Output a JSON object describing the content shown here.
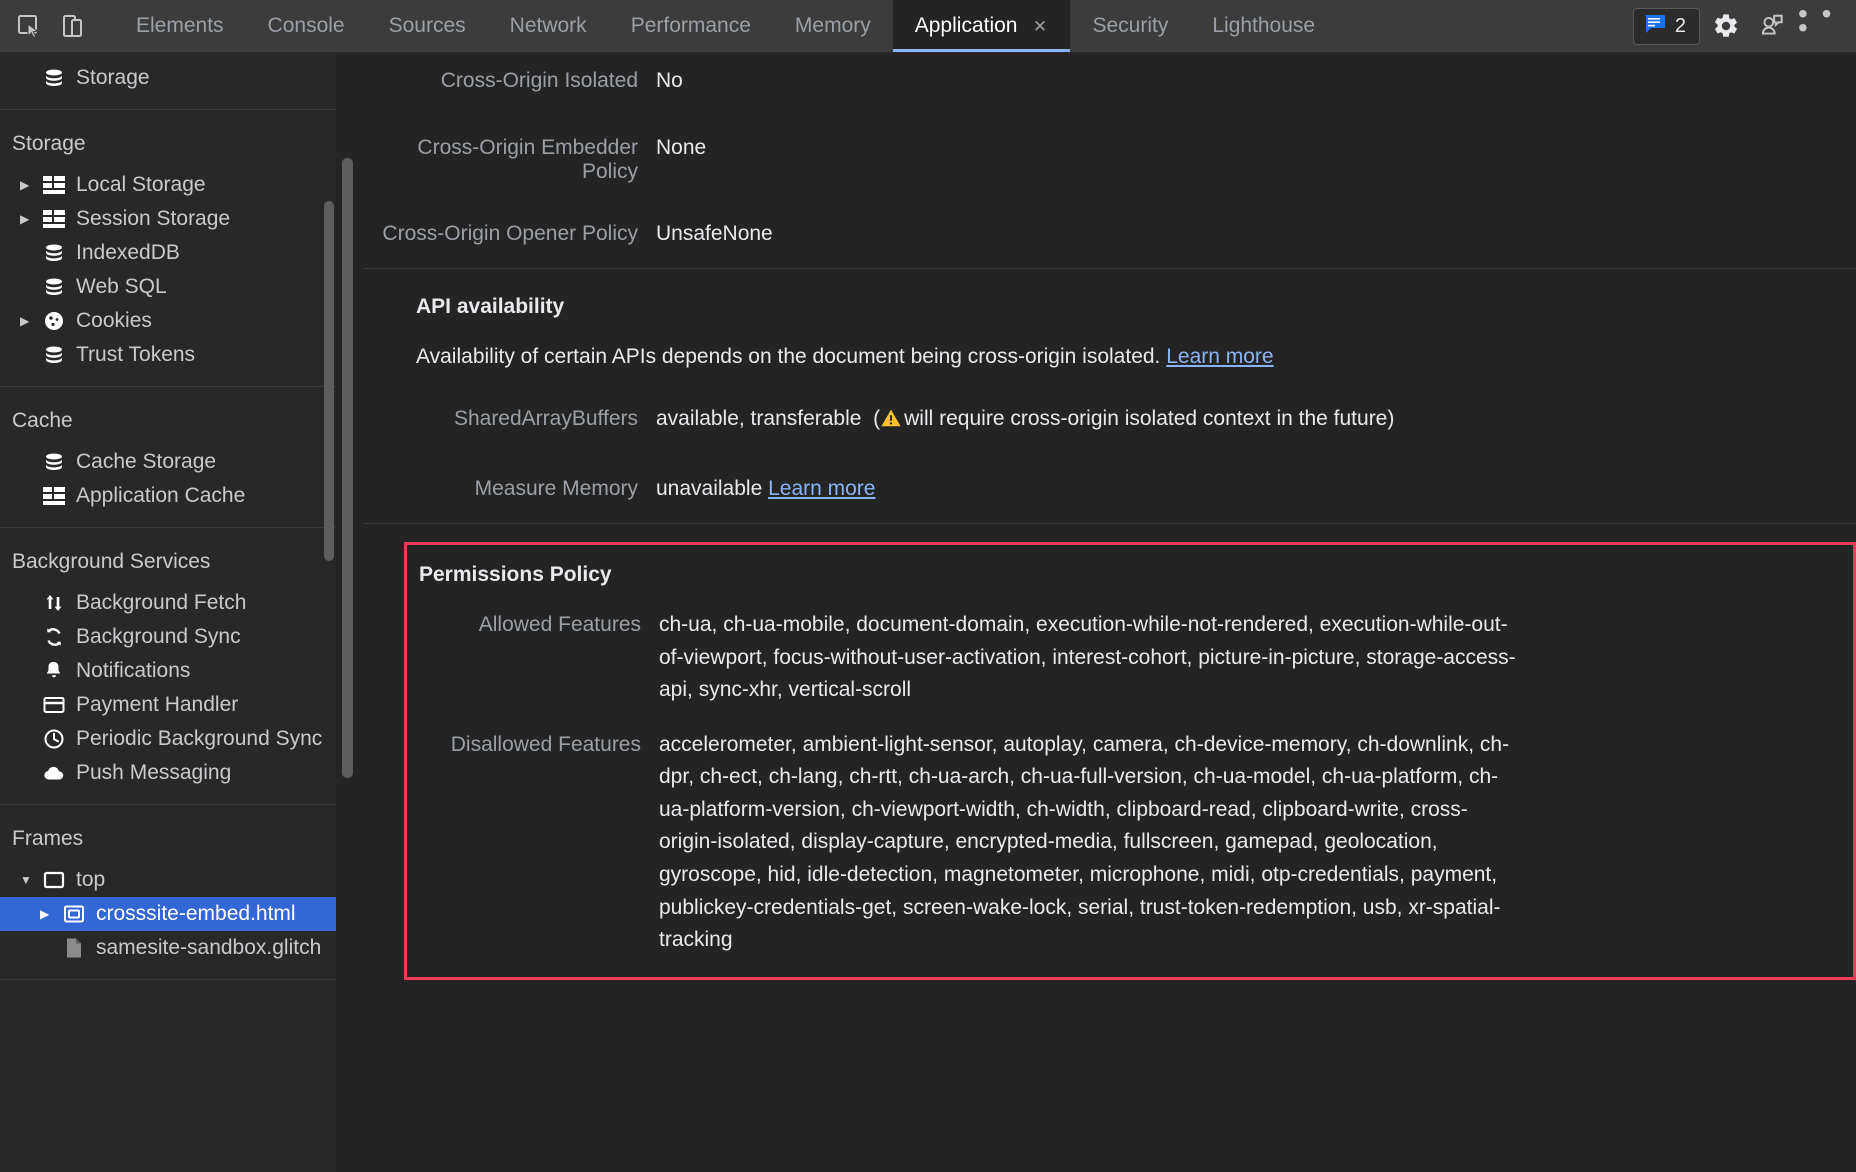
{
  "toolbar": {
    "icons": [
      {
        "name": "inspect-element-icon",
        "label": "Inspect element"
      },
      {
        "name": "device-toolbar-icon",
        "label": "Toggle device toolbar"
      }
    ],
    "tabs": [
      {
        "label": "Elements",
        "active": false
      },
      {
        "label": "Console",
        "active": false
      },
      {
        "label": "Sources",
        "active": false
      },
      {
        "label": "Network",
        "active": false
      },
      {
        "label": "Performance",
        "active": false
      },
      {
        "label": "Memory",
        "active": false
      },
      {
        "label": "Application",
        "active": true,
        "closeable": true
      },
      {
        "label": "Security",
        "active": false
      },
      {
        "label": "Lighthouse",
        "active": false
      }
    ],
    "close_glyph": "✕",
    "message_badge": {
      "icon": "message-bubble-icon",
      "count": "2",
      "color": "#1a73e8"
    },
    "settings_icon": "gear-icon",
    "customize_icon": "more-options-icon",
    "more_glyph": "• • •"
  },
  "sidebar": {
    "sections": [
      {
        "title": "",
        "items": [
          {
            "label": "Storage",
            "icon": "database-icon",
            "arrow": false,
            "indent": 1
          }
        ]
      },
      {
        "title": "Storage",
        "items": [
          {
            "label": "Local Storage",
            "icon": "table-icon",
            "arrow": true,
            "indent": 1
          },
          {
            "label": "Session Storage",
            "icon": "table-icon",
            "arrow": true,
            "indent": 1
          },
          {
            "label": "IndexedDB",
            "icon": "database-icon",
            "arrow": false,
            "indent": 1
          },
          {
            "label": "Web SQL",
            "icon": "database-icon",
            "arrow": false,
            "indent": 1
          },
          {
            "label": "Cookies",
            "icon": "cookie-icon",
            "arrow": true,
            "indent": 1
          },
          {
            "label": "Trust Tokens",
            "icon": "database-icon",
            "arrow": false,
            "indent": 1
          }
        ]
      },
      {
        "title": "Cache",
        "items": [
          {
            "label": "Cache Storage",
            "icon": "database-icon",
            "arrow": false,
            "indent": 1
          },
          {
            "label": "Application Cache",
            "icon": "table-icon",
            "arrow": false,
            "indent": 1
          }
        ]
      },
      {
        "title": "Background Services",
        "items": [
          {
            "label": "Background Fetch",
            "icon": "updown-arrows-icon",
            "arrow": false,
            "indent": 1
          },
          {
            "label": "Background Sync",
            "icon": "sync-icon",
            "arrow": false,
            "indent": 1
          },
          {
            "label": "Notifications",
            "icon": "bell-icon",
            "arrow": false,
            "indent": 1
          },
          {
            "label": "Payment Handler",
            "icon": "credit-card-icon",
            "arrow": false,
            "indent": 1
          },
          {
            "label": "Periodic Background Sync",
            "icon": "clock-icon",
            "arrow": false,
            "indent": 1
          },
          {
            "label": "Push Messaging",
            "icon": "cloud-icon",
            "arrow": false,
            "indent": 1
          }
        ]
      },
      {
        "title": "Frames",
        "items": [
          {
            "label": "top",
            "icon": "frame-icon",
            "arrow": true,
            "expanded": true,
            "indent": 1
          },
          {
            "label": "crosssite-embed.html",
            "icon": "iframe-icon",
            "arrow": true,
            "indent": 2,
            "selected": true
          },
          {
            "label": "samesite-sandbox.glitch",
            "icon": "document-icon",
            "arrow": false,
            "indent": 2
          }
        ]
      }
    ],
    "arrow_collapsed": "▶",
    "arrow_expanded": "▼",
    "selected_color": "#3367d6"
  },
  "main": {
    "security_rows": [
      {
        "label": "Cross-Origin Isolated",
        "value": "No"
      },
      {
        "label": "Cross-Origin Embedder Policy",
        "value": "None"
      },
      {
        "label": "Cross-Origin Opener Policy",
        "value": "UnsafeNone"
      }
    ],
    "api_availability": {
      "heading": "API availability",
      "description": "Availability of certain APIs depends on the document being cross-origin isolated. ",
      "description_link": "Learn more",
      "shared_array_buffers": {
        "label": "SharedArrayBuffers",
        "value": "available, transferable",
        "note_open": "(",
        "warning_icon": "warning-triangle-icon",
        "note": "will require cross-origin isolated context in the future)"
      },
      "measure_memory": {
        "label": "Measure Memory",
        "value": "unavailable ",
        "link": "Learn more"
      }
    },
    "permissions_policy": {
      "heading": "Permissions Policy",
      "highlight_color": "#f23a5b",
      "allowed": {
        "label": "Allowed Features",
        "value": "ch-ua, ch-ua-mobile, document-domain, execution-while-not-rendered, execution-while-out-of-viewport, focus-without-user-activation, interest-cohort, picture-in-picture, storage-access-api, sync-xhr, vertical-scroll"
      },
      "disallowed": {
        "label": "Disallowed Features",
        "value": "accelerometer, ambient-light-sensor, autoplay, camera, ch-device-memory, ch-downlink, ch-dpr, ch-ect, ch-lang, ch-rtt, ch-ua-arch, ch-ua-full-version, ch-ua-model, ch-ua-platform, ch-ua-platform-version, ch-viewport-width, ch-width, clipboard-read, clipboard-write, cross-origin-isolated, display-capture, encrypted-media, fullscreen, gamepad, geolocation, gyroscope, hid, idle-detection, magnetometer, microphone, midi, otp-credentials, payment, publickey-credentials-get, screen-wake-lock, serial, trust-token-redemption, usb, xr-spatial-tracking"
      }
    }
  }
}
